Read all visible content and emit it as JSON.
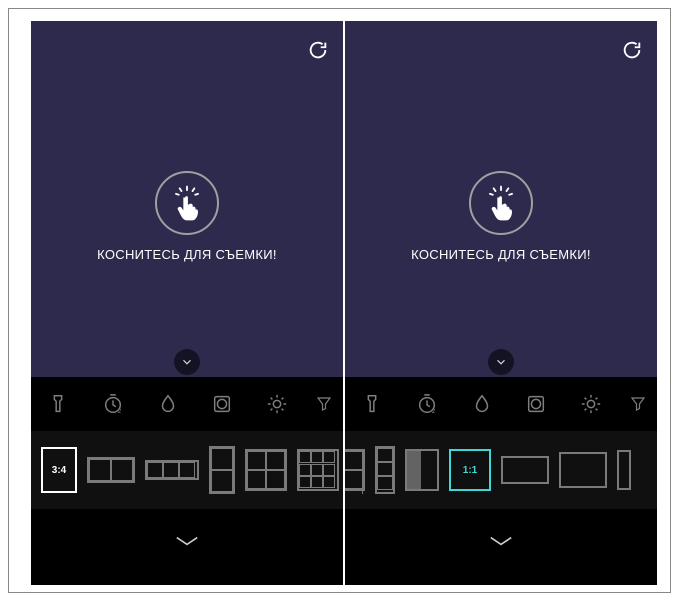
{
  "screens": {
    "left": {
      "tap_label": "КОСНИТЕСЬ ДЛЯ СЪЕМКИ!",
      "ratios": {
        "selected_index": 0,
        "items": [
          {
            "id": "3-4",
            "label": "3:4"
          },
          {
            "id": "h2"
          },
          {
            "id": "h3"
          },
          {
            "id": "v2"
          },
          {
            "id": "grid2x2"
          },
          {
            "id": "grid3x3"
          },
          {
            "id": "grid4x2-partial"
          }
        ]
      },
      "tools": [
        {
          "id": "flash"
        },
        {
          "id": "timer"
        },
        {
          "id": "drop"
        },
        {
          "id": "vignette"
        },
        {
          "id": "brightness"
        },
        {
          "id": "filter-partial"
        }
      ]
    },
    "right": {
      "tap_label": "КОСНИТЕСЬ ДЛЯ СЪЕМКИ!",
      "ratios": {
        "selected_index": 3,
        "items": [
          {
            "id": "grid2x2-partial"
          },
          {
            "id": "v3"
          },
          {
            "id": "grad"
          },
          {
            "id": "1-1",
            "label": "1:1"
          },
          {
            "id": "box-a"
          },
          {
            "id": "box-b"
          },
          {
            "id": "box-c-partial"
          }
        ]
      },
      "tools": [
        {
          "id": "flash"
        },
        {
          "id": "timer"
        },
        {
          "id": "drop"
        },
        {
          "id": "vignette"
        },
        {
          "id": "brightness"
        },
        {
          "id": "filter-partial"
        }
      ]
    }
  },
  "icon_names": {
    "flash": "flashlight-icon",
    "timer": "timer-icon",
    "drop": "drop-icon",
    "vignette": "vignette-icon",
    "brightness": "brightness-icon",
    "filter": "filter-icon",
    "reset": "rotate-icon",
    "chevron_down": "chevron-down-icon",
    "tap_hand": "tap-hand-icon"
  },
  "colors": {
    "viewfinder_bg": "#2e2a4e",
    "selected_white": "#ffffff",
    "selected_cyan": "#3fd8d8",
    "icon_stroke": "#aaaaaa"
  }
}
